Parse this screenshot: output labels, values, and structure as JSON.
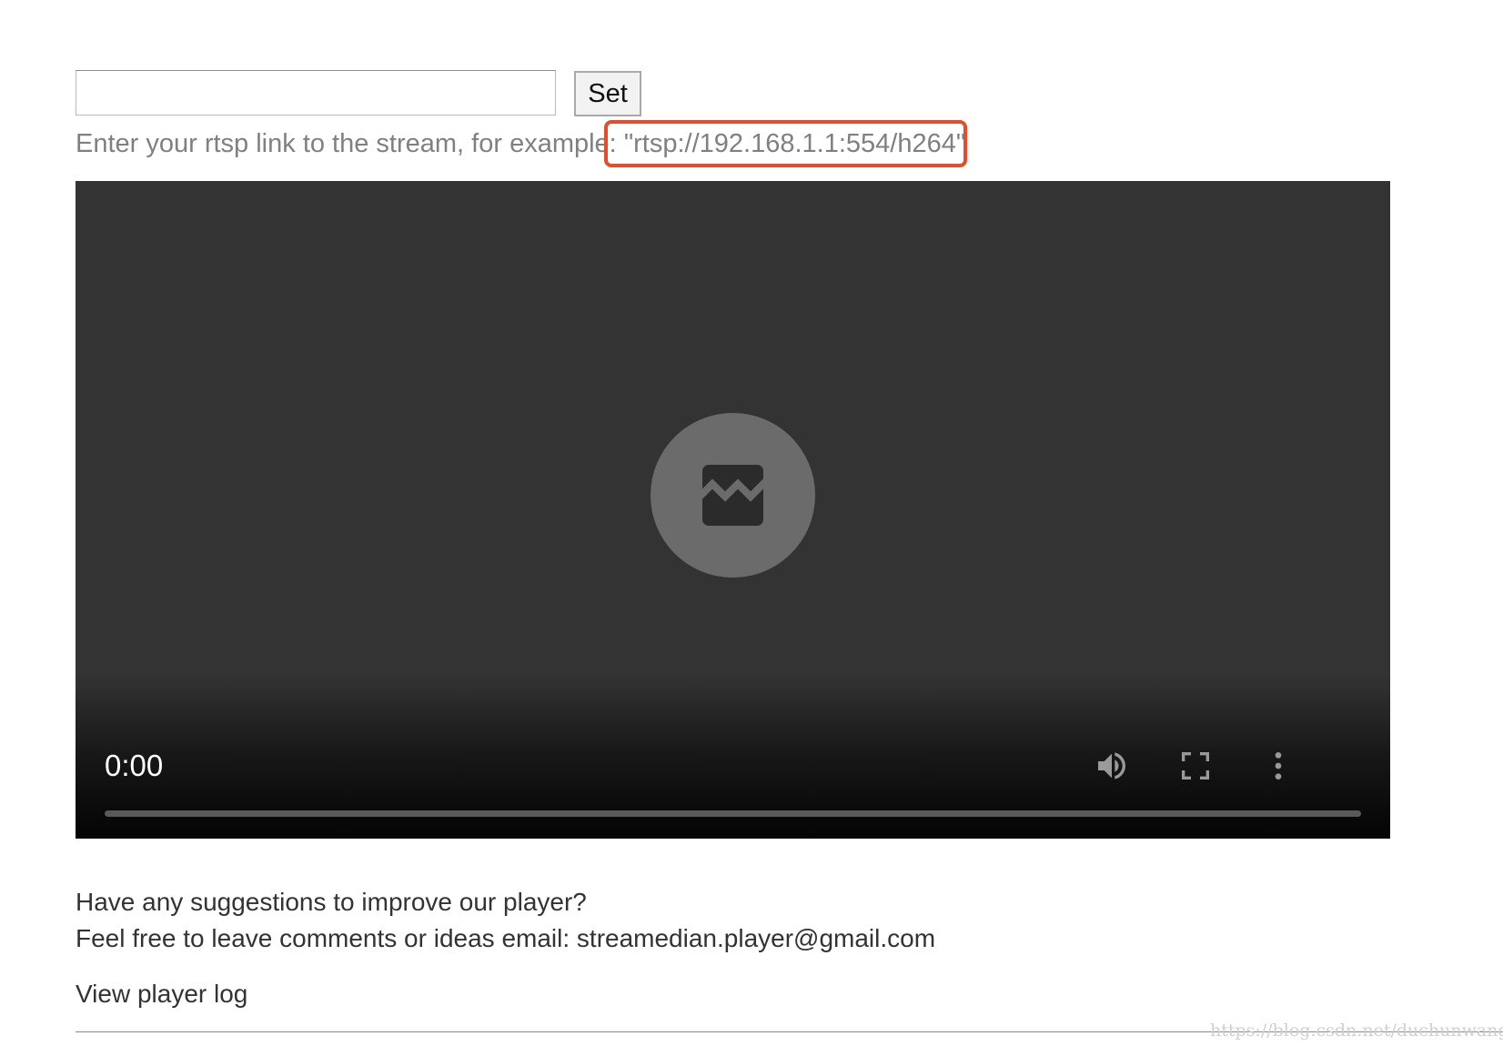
{
  "stream_form": {
    "url_input": {
      "value": "",
      "placeholder": ""
    },
    "set_label": "Set",
    "hint_prefix": "Enter your rtsp link to the stream, for example: ",
    "hint_example": "\"rtsp://192.168.1.1:554/h264\"",
    "highlight_color": "#e24e2b"
  },
  "player": {
    "background": "#333333",
    "error_icon": "broken-image-icon",
    "time": "0:00",
    "progress": 0,
    "controls": {
      "volume_icon": "volume-up-icon",
      "fullscreen_icon": "fullscreen-icon",
      "more_icon": "more-vert-icon"
    }
  },
  "feedback": {
    "line1": "Have any suggestions to improve our player?",
    "line2": "Feel free to leave comments or ideas email: streamedian.player@gmail.com"
  },
  "log_link": "View player log",
  "watermark": "https://blog.csdn.net/duchunwang"
}
